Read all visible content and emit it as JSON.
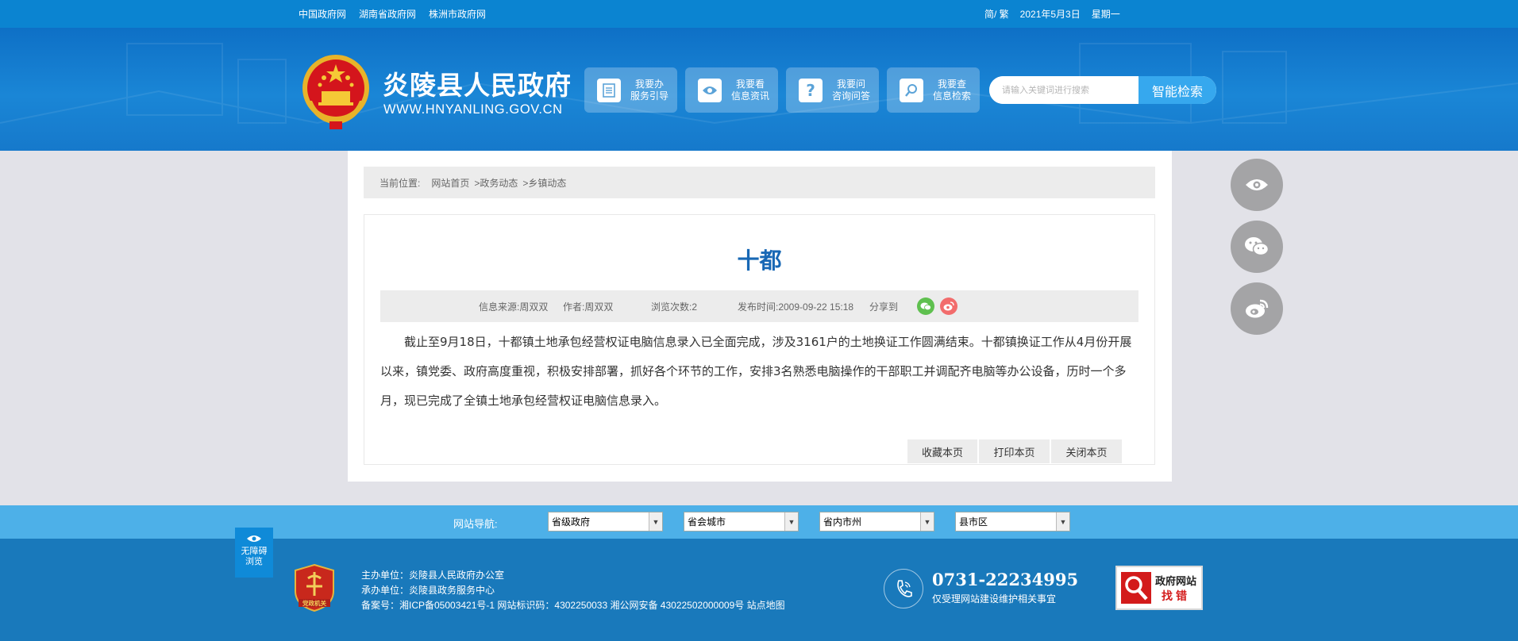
{
  "topbar": {
    "links": [
      "中国政府网",
      "湖南省政府网",
      "株洲市政府网"
    ],
    "lang": "简/ 繁",
    "date": "2021年5月3日",
    "weekday": "星期一"
  },
  "header": {
    "title": "炎陵县人民政府",
    "domain": "WWW.HNYANLING.GOV.CN",
    "quick_links": [
      {
        "line1": "我要办",
        "line2": "服务引导",
        "icon": "document-icon"
      },
      {
        "line1": "我要看",
        "line2": "信息资讯",
        "icon": "eye-icon"
      },
      {
        "line1": "我要问",
        "line2": "咨询问答",
        "icon": "question-icon"
      },
      {
        "line1": "我要查",
        "line2": "信息检索",
        "icon": "magnifier-icon"
      }
    ],
    "search": {
      "placeholder": "请输入关键词进行搜索",
      "button": "智能检索"
    }
  },
  "breadcrumb": {
    "label": "当前位置:",
    "items": [
      "网站首页",
      ">政务动态",
      ">乡镇动态"
    ]
  },
  "article": {
    "title": "十都",
    "source": "信息来源:周双双",
    "author": "作者:周双双",
    "views": "浏览次数:2",
    "published": "发布时间:2009-09-22 15:18",
    "share_label": "分享到",
    "body": "截止至9月18日，十都镇土地承包经营权证电脑信息录入已全面完成，涉及3161户的土地换证工作圆满结束。十都镇换证工作从4月份开展以来，镇党委、政府高度重视，积极安排部署，抓好各个环节的工作，安排3名熟悉电脑操作的干部职工并调配齐电脑等办公设备，历时一个多月，现已完成了全镇土地承包经营权证电脑信息录入。",
    "actions": [
      "收藏本页",
      "打印本页",
      "关闭本页"
    ]
  },
  "footer_nav": {
    "label": "网站导航:",
    "selects": [
      "省级政府",
      "省会城市",
      "省内市州",
      "县市区"
    ]
  },
  "footer": {
    "accessibility": {
      "line1": "无障碍",
      "line2": "浏览"
    },
    "host": "主办单位：炎陵县人民政府办公室",
    "organizer": "承办单位：炎陵县政务服务中心",
    "record": "备案号：湘ICP备05003421号-1 网站标识码：4302250033 湘公网安备 43022502000009号 站点地图",
    "phone": "0731-22234995",
    "phone_note": "仅受理网站建设维护相关事宜",
    "findbug_line1": "政府网站",
    "findbug_line2": "找错",
    "badge_text": "党政机关"
  },
  "colors": {
    "topbar": "#0b84d1",
    "header": "#1a86d6",
    "title_blue": "#1868b5",
    "footer": "#1979bb",
    "footer_nav": "#4db0e8"
  }
}
